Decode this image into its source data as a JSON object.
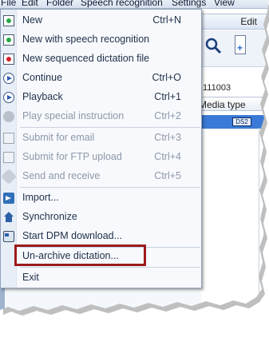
{
  "menubar": {
    "items": [
      "File",
      "Edit",
      "Folder",
      "Speech recognition",
      "Settings",
      "View"
    ]
  },
  "background_window": {
    "edit_label": "Edit",
    "number_text": "111003",
    "column_header": "Media type",
    "badge_text": "DS2"
  },
  "menu": {
    "items": [
      {
        "label": "New",
        "shortcut": "Ctrl+N",
        "icon": "record-green-icon",
        "enabled": true
      },
      {
        "label": "New with speech recognition",
        "shortcut": "",
        "icon": "record-green-icon",
        "enabled": true
      },
      {
        "label": "New sequenced dictation file",
        "shortcut": "",
        "icon": "record-red-icon",
        "enabled": true
      },
      {
        "label": "Continue",
        "shortcut": "Ctrl+O",
        "icon": "continue-icon",
        "enabled": true
      },
      {
        "label": "Playback",
        "shortcut": "Ctrl+1",
        "icon": "play-icon",
        "enabled": true
      },
      {
        "label": "Play special instruction",
        "shortcut": "Ctrl+2",
        "icon": "speech-bubble-icon",
        "enabled": false
      },
      {
        "label": "Submit for email",
        "shortcut": "Ctrl+3",
        "icon": "email-icon",
        "enabled": false
      },
      {
        "label": "Submit for FTP upload",
        "shortcut": "Ctrl+4",
        "icon": "ftp-icon",
        "enabled": false
      },
      {
        "label": "Send and receive",
        "shortcut": "Ctrl+5",
        "icon": "send-receive-icon",
        "enabled": false
      },
      {
        "label": "Import...",
        "shortcut": "",
        "icon": "import-icon",
        "enabled": true
      },
      {
        "label": "Synchronize",
        "shortcut": "",
        "icon": "synchronize-icon",
        "enabled": true
      },
      {
        "label": "Start DPM download...",
        "shortcut": "",
        "icon": "dpm-device-icon",
        "enabled": true
      },
      {
        "label": "Un-archive dictation...",
        "shortcut": "",
        "icon": "",
        "enabled": true
      },
      {
        "label": "Exit",
        "shortcut": "",
        "icon": "",
        "enabled": true
      }
    ]
  },
  "colors": {
    "highlight_border": "#9b1b1d",
    "selection": "#3a7ad6"
  }
}
